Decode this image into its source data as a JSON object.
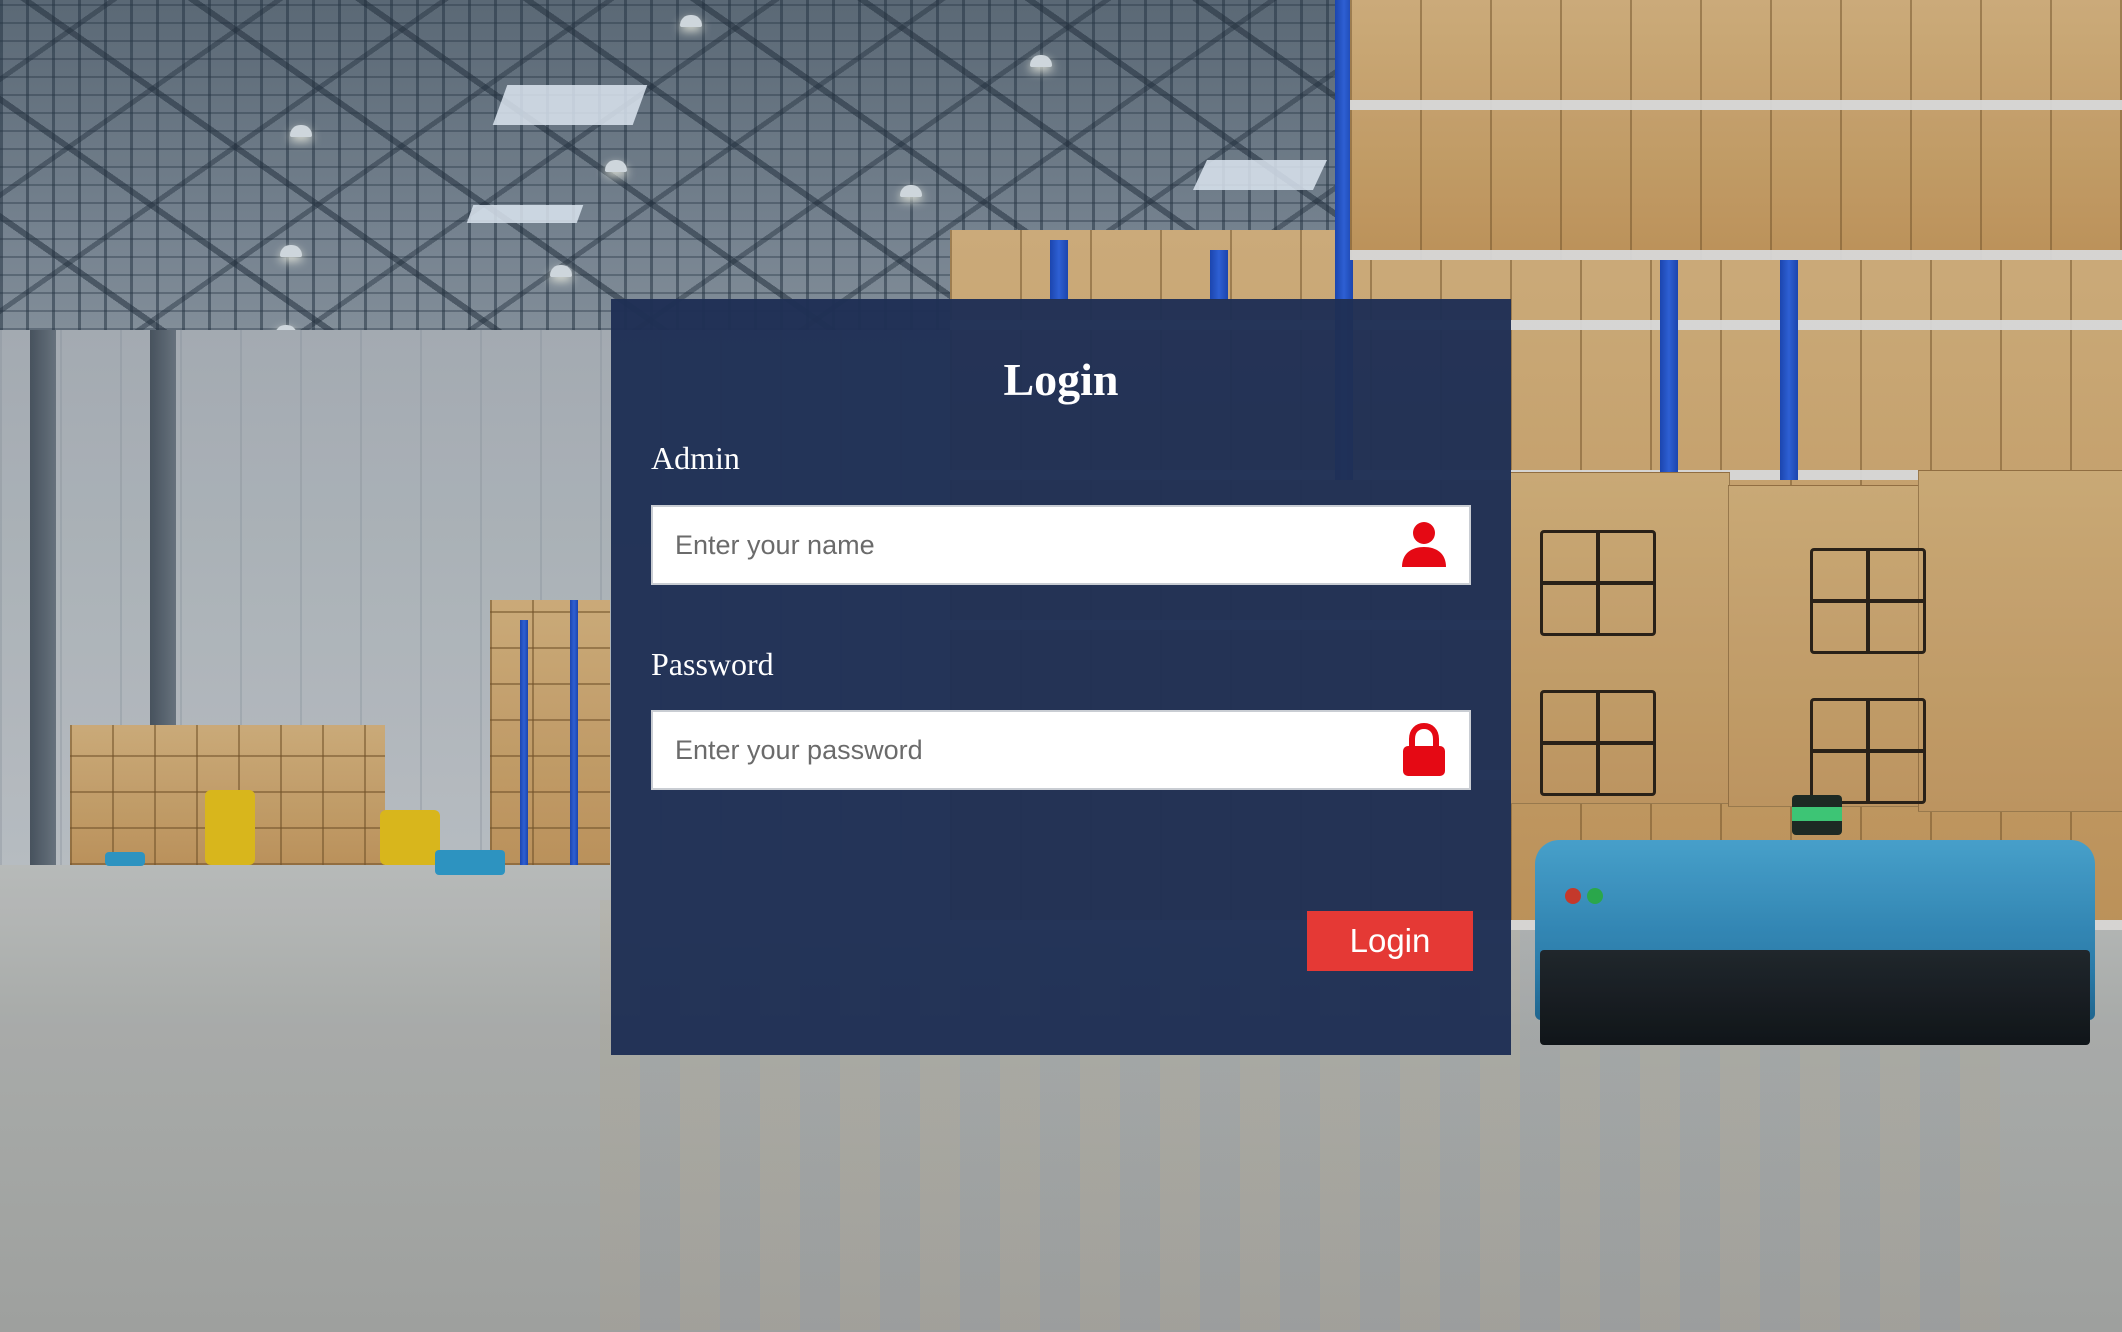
{
  "login": {
    "title": "Login",
    "admin_label": "Admin",
    "name_placeholder": "Enter your name",
    "name_value": "",
    "password_label": "Password",
    "password_placeholder": "Enter your password",
    "password_value": "",
    "submit_label": "Login",
    "icons": {
      "name_field": "user-icon",
      "password_field": "lock-icon"
    },
    "colors": {
      "panel_background": "#1f2f55",
      "accent": "#e53935",
      "icon": "#e50914"
    }
  }
}
